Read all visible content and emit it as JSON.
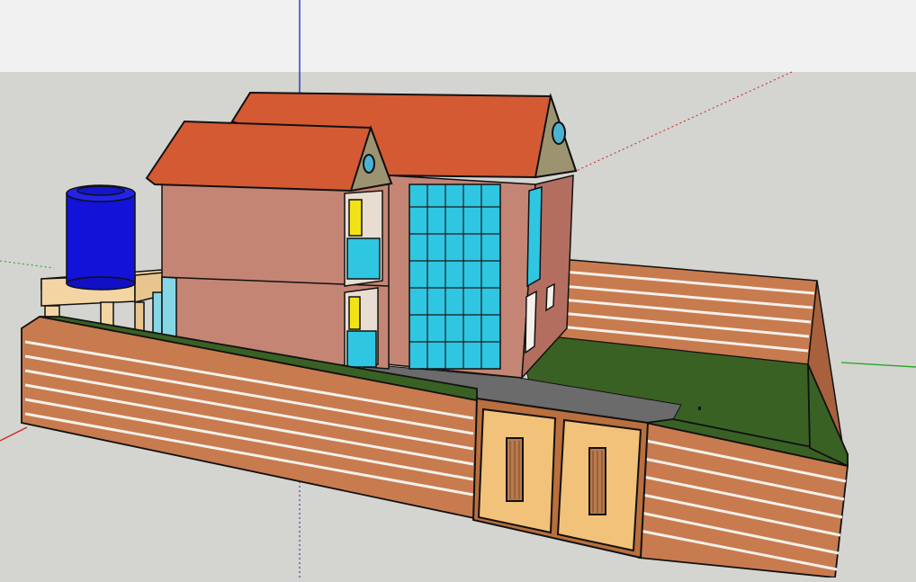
{
  "viewport": {
    "sky_color": "#f1f1f1",
    "ground_color": "#d4d4d0"
  },
  "axes": {
    "red": "#d22020",
    "green": "#1fa61f",
    "blue": "#2020c8"
  },
  "model": {
    "roof_color": "#d45a33",
    "brick_color": "#b97a6b",
    "glass_color": "#2fc6e2",
    "fence_color": "#c87b4f",
    "lawn_color": "#3a6124",
    "path_color": "#6b6b6b",
    "gate_color": "#f2c27a",
    "tank_color": "#1212d8",
    "stand_color": "#f3d5a4",
    "window_yellow": "#f2e317"
  }
}
